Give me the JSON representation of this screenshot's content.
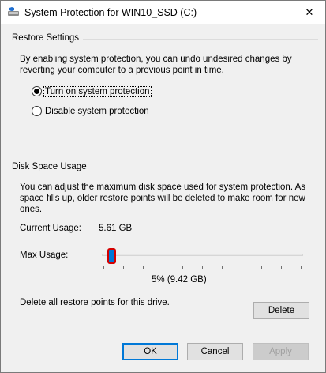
{
  "window": {
    "title": "System Protection for WIN10_SSD (C:)",
    "close_symbol": "✕"
  },
  "restore_settings": {
    "heading": "Restore Settings",
    "description_line1": "By enabling system protection, you can undo undesired changes by",
    "description_line2": "reverting your computer to a previous point in time.",
    "options": [
      {
        "label": "Turn on system protection",
        "selected": true
      },
      {
        "label": "Disable system protection",
        "selected": false
      }
    ]
  },
  "disk_space": {
    "heading": "Disk Space Usage",
    "description_line1": "You can adjust the maximum disk space used for system protection. As",
    "description_line2": "space fills up, older restore points will be deleted to make room for new",
    "description_line3": "ones.",
    "current_usage_label": "Current Usage:",
    "current_usage_value": "5.61 GB",
    "max_usage_label": "Max Usage:",
    "max_usage_readout": "5% (9.42 GB)",
    "max_usage_percent": 5,
    "delete_description": "Delete all restore points for this drive.",
    "delete_button": "Delete"
  },
  "footer": {
    "ok": "OK",
    "cancel": "Cancel",
    "apply": "Apply"
  },
  "colors": {
    "accent": "#0078d7",
    "highlight": "#d40000"
  },
  "icons": {
    "title": "drive-shield-icon",
    "close": "close-icon"
  }
}
